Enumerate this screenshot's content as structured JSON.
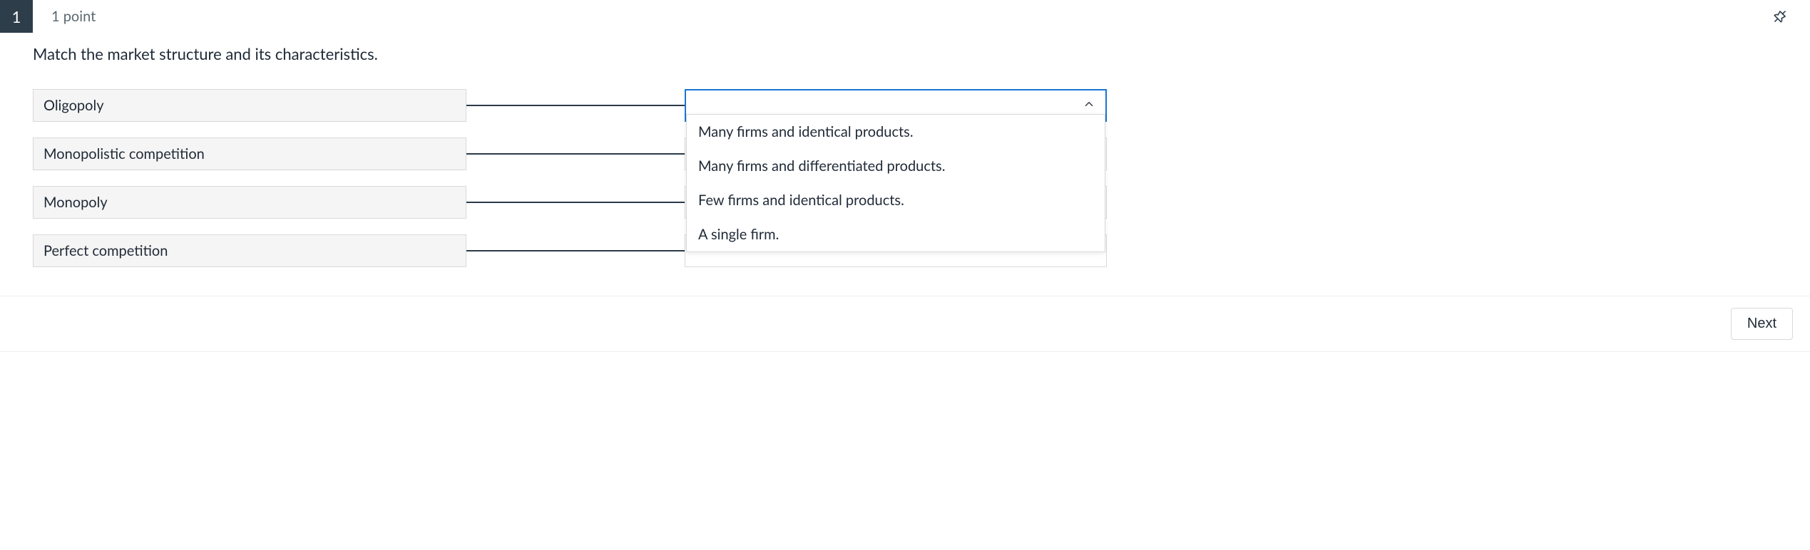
{
  "question": {
    "number": "1",
    "points_label": "1 point",
    "prompt": "Match the market structure and its characteristics.",
    "terms": [
      "Oligopoly",
      "Monopolistic competition",
      "Monopoly",
      "Perfect competition"
    ],
    "dropdown": {
      "open_for_index": 0,
      "options": [
        "Many firms and identical products.",
        "Many firms and differentiated products.",
        "Few firms and identical products.",
        "A single firm."
      ]
    }
  },
  "footer": {
    "next_label": "Next"
  }
}
